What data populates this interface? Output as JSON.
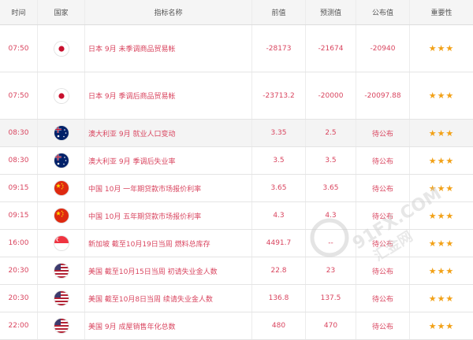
{
  "header": {
    "time": "时间",
    "country": "国家",
    "indicator": "指标名称",
    "previous": "前值",
    "forecast": "预测值",
    "actual": "公布值",
    "importance": "重要性"
  },
  "rows": [
    {
      "time": "07:50",
      "flag": "japan-flag-icon",
      "indicator": "日本 9月 未季调商品贸易帐",
      "previous": "-28173",
      "forecast": "-21674",
      "actual": "-20940",
      "stars": "★★★"
    },
    {
      "time": "07:50",
      "flag": "japan-flag-icon",
      "indicator": "日本 9月 季调后商品贸易帐",
      "previous": "-23713.2",
      "forecast": "-20000",
      "actual": "-20097.88",
      "stars": "★★★"
    },
    {
      "time": "08:30",
      "flag": "australia-flag-icon",
      "indicator": "澳大利亚 9月 就业人口变动",
      "previous": "3.35",
      "forecast": "2.5",
      "actual": "待公布",
      "stars": "★★★"
    },
    {
      "time": "08:30",
      "flag": "australia-flag-icon",
      "indicator": "澳大利亚 9月 季调后失业率",
      "previous": "3.5",
      "forecast": "3.5",
      "actual": "待公布",
      "stars": "★★★"
    },
    {
      "time": "09:15",
      "flag": "china-flag-icon",
      "indicator": "中国 10月 一年期贷款市场报价利率",
      "previous": "3.65",
      "forecast": "3.65",
      "actual": "待公布",
      "stars": "★★★"
    },
    {
      "time": "09:15",
      "flag": "china-flag-icon",
      "indicator": "中国 10月 五年期贷款市场报价利率",
      "previous": "4.3",
      "forecast": "4.3",
      "actual": "待公布",
      "stars": "★★★"
    },
    {
      "time": "16:00",
      "flag": "singapore-flag-icon",
      "indicator": "新加坡 截至10月19日当周 燃料总库存",
      "previous": "4491.7",
      "forecast": "--",
      "actual": "待公布",
      "stars": "★★★"
    },
    {
      "time": "20:30",
      "flag": "usa-flag-icon",
      "indicator": "美国 截至10月15日当周 初请失业金人数",
      "previous": "22.8",
      "forecast": "23",
      "actual": "待公布",
      "stars": "★★★"
    },
    {
      "time": "20:30",
      "flag": "usa-flag-icon",
      "indicator": "美国 截至10月8日当周 续请失业金人数",
      "previous": "136.8",
      "forecast": "137.5",
      "actual": "待公布",
      "stars": "★★★"
    },
    {
      "time": "22:00",
      "flag": "usa-flag-icon",
      "indicator": "美国 9月 成屋销售年化总数",
      "previous": "480",
      "forecast": "470",
      "actual": "待公布",
      "stars": "★★★"
    }
  ],
  "watermark": {
    "text": "91FX.COM",
    "subtext": "汇金网"
  }
}
